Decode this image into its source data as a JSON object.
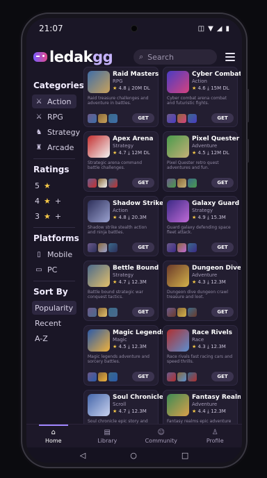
{
  "status": {
    "time": "21:07",
    "icons": [
      "vibrate-icon",
      "wifi-icon",
      "signal-icon",
      "battery-icon"
    ]
  },
  "header": {
    "logo_accent": "gg",
    "logo_main": "ledak",
    "search_placeholder": "Search"
  },
  "sidebar": {
    "categories_title": "Categories",
    "categories": [
      {
        "label": "Action",
        "icon": "swords-icon",
        "glyph": "⚔"
      },
      {
        "label": "RPG",
        "icon": "sword-cross-icon",
        "glyph": "⚔"
      },
      {
        "label": "Strategy",
        "icon": "strategy-icon",
        "glyph": "♞"
      },
      {
        "label": "Arcade",
        "icon": "joystick-icon",
        "glyph": "♜"
      }
    ],
    "ratings_title": "Ratings",
    "ratings": [
      {
        "label": "5",
        "suffix": ""
      },
      {
        "label": "4",
        "suffix": "+"
      },
      {
        "label": "3",
        "suffix": "+"
      }
    ],
    "platforms_title": "Platforms",
    "platforms": [
      {
        "label": "Mobile",
        "icon": "phone-icon"
      },
      {
        "label": "PC",
        "icon": "monitor-icon"
      }
    ],
    "sort_title": "Sort By",
    "sort": [
      "Popularity",
      "Recent",
      "A-Z"
    ]
  },
  "games": [
    {
      "title": "Raid Masters",
      "genre": "RPG",
      "rating": "4.8",
      "downloads": "20M DL",
      "desc": "Raid treasure challenges and adventure in battles.",
      "colors": [
        "#3f6ea8",
        "#c9a15a"
      ]
    },
    {
      "title": "Cyber Combat",
      "genre": "Action",
      "rating": "4.6",
      "downloads": "15M DL",
      "desc": "Cyber combat arena combat and futuristic fights.",
      "colors": [
        "#4a3cc2",
        "#d5427f"
      ]
    },
    {
      "title": "Apex Arena",
      "genre": "Strategy",
      "rating": "4.7",
      "downloads": "12M DL",
      "desc": "Strategic arena command battle challenges.",
      "colors": [
        "#c43131",
        "#f2f2f2"
      ]
    },
    {
      "title": "Pixel Quester",
      "genre": "Adventure",
      "rating": "4.5",
      "downloads": "12M DL",
      "desc": "Pixel Quester retro quest adventures and fun.",
      "colors": [
        "#4a9a4c",
        "#c5b077"
      ]
    },
    {
      "title": "Shadow Strike",
      "genre": "Action",
      "rating": "4.8",
      "downloads": "20.3M",
      "desc": "Shadow strike stealth action and ninja battles.",
      "colors": [
        "#2d2f5a",
        "#9ba2d0"
      ]
    },
    {
      "title": "Galaxy Guard",
      "genre": "Strategy",
      "rating": "4.9",
      "downloads": "15.3M",
      "desc": "Guard galaxy defending space fleet attack.",
      "colors": [
        "#3b2a86",
        "#c06ad6"
      ]
    },
    {
      "title": "Bettle Bound",
      "genre": "Strategy",
      "rating": "4.7",
      "downloads": "12.3M",
      "desc": "Battle bound strategic war conquest tactics.",
      "colors": [
        "#4b6a8c",
        "#e3c06b"
      ]
    },
    {
      "title": "Dungeon Dive",
      "genre": "Adventure",
      "rating": "4.3",
      "downloads": "12.3M",
      "desc": "Dungeon dive dungeon crawl treasure and loot.",
      "colors": [
        "#6b3a2a",
        "#d4b24a"
      ]
    },
    {
      "title": "Magic Legends",
      "genre": "Magic",
      "rating": "4.5",
      "downloads": "12.3M",
      "desc": "Magic legends adventure and sorcery battles.",
      "colors": [
        "#2b5aa8",
        "#f0b23c"
      ]
    },
    {
      "title": "Race Rivels",
      "genre": "Race",
      "rating": "4.3",
      "downloads": "12.3M",
      "desc": "Race rivals fast racing cars and speed thrills.",
      "colors": [
        "#b03030",
        "#5b8fd0"
      ]
    },
    {
      "title": "Soul Chronicle",
      "genre": "Scroll",
      "rating": "4.7",
      "downloads": "12.3M",
      "desc": "Soul chronicle epic story and mystical journey.",
      "colors": [
        "#4466aa",
        "#c9d2ee"
      ]
    },
    {
      "title": "Fantasy Realms",
      "genre": "Adventure",
      "rating": "4.4",
      "downloads": "12.3M",
      "desc": "Fantasy realms epic adventure in magical lands.",
      "colors": [
        "#3d8a55",
        "#d9a04a"
      ]
    }
  ],
  "get_label": "GET",
  "nav": [
    {
      "label": "Home",
      "icon": "home-icon",
      "glyph": "⌂"
    },
    {
      "label": "Library",
      "icon": "library-icon",
      "glyph": "▤"
    },
    {
      "label": "Community",
      "icon": "community-icon",
      "glyph": "☺"
    },
    {
      "label": "Profile",
      "icon": "profile-icon",
      "glyph": "♙"
    }
  ],
  "system_nav": [
    {
      "icon": "back-icon",
      "glyph": "◁"
    },
    {
      "icon": "home-circle-icon",
      "glyph": "○"
    },
    {
      "icon": "recents-icon",
      "glyph": "□"
    }
  ]
}
